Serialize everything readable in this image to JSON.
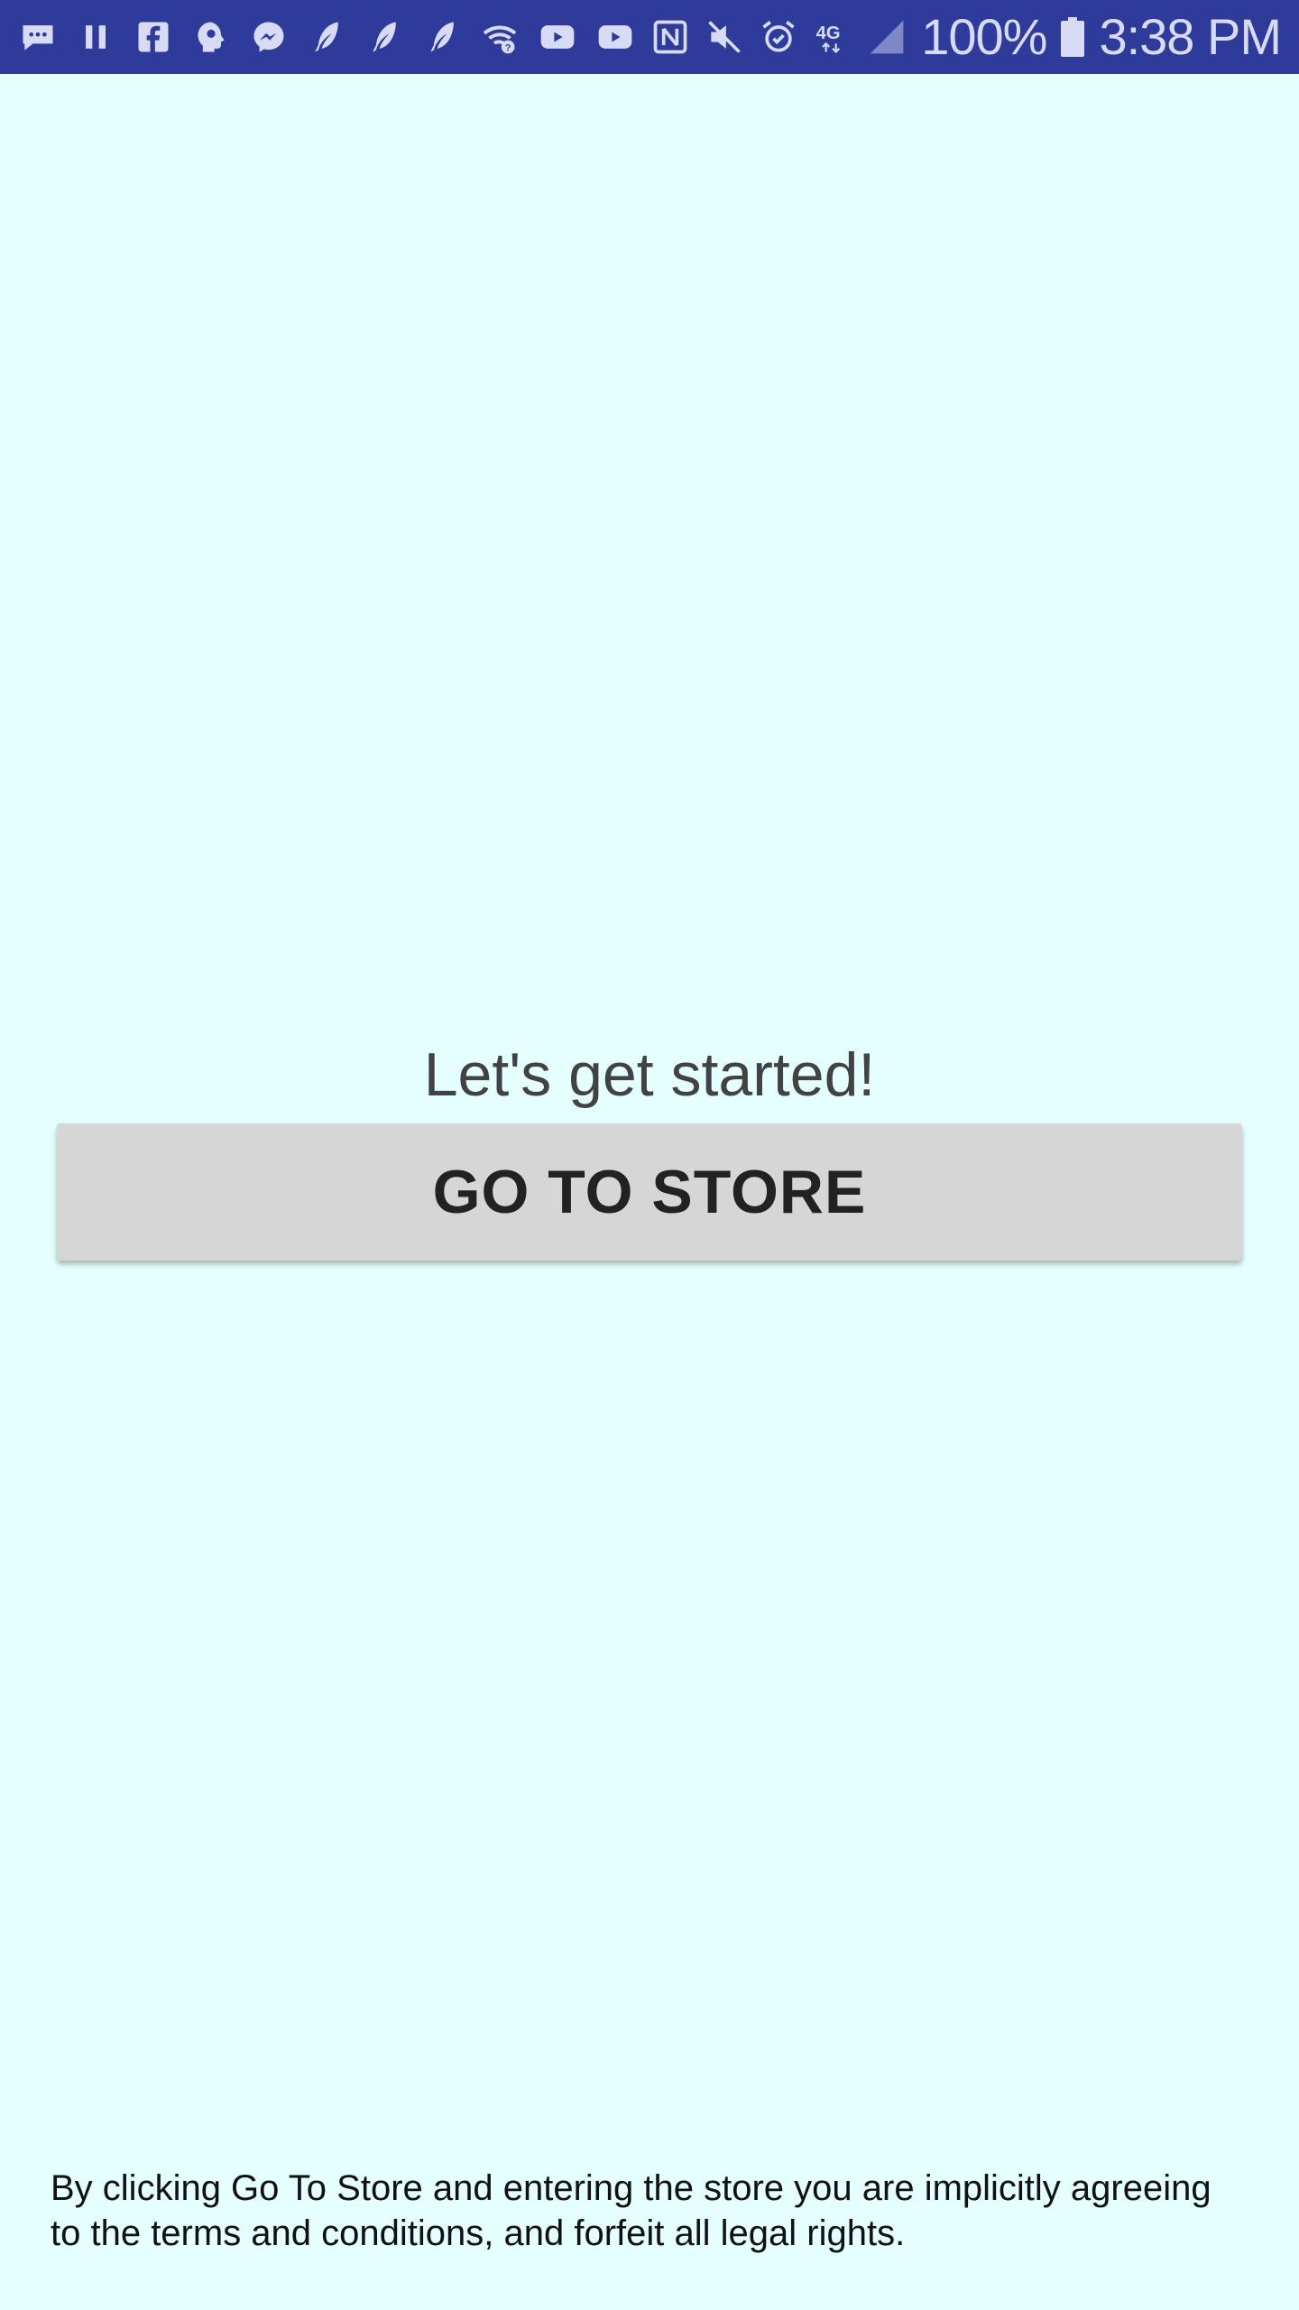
{
  "status_bar": {
    "battery_percent": "100%",
    "time": "3:38 PM",
    "network_label": "4G",
    "background_color": "#2f3b9b",
    "icons_left": [
      "chat-icon",
      "pause-icon",
      "facebook-icon",
      "mind-icon",
      "messenger-icon",
      "feather-icon",
      "feather-icon",
      "feather-icon",
      "wifi-question-icon",
      "youtube-icon",
      "youtube-icon"
    ],
    "icons_right": [
      "nfc-icon",
      "mute-icon",
      "alarm-icon",
      "lte-icon",
      "signal-icon",
      "battery-icon"
    ]
  },
  "main": {
    "title": "Let's get started!",
    "button_label": "GO TO STORE",
    "background_color": "#e4fffd",
    "button_color": "#d6d6d6"
  },
  "footer": {
    "disclaimer": "By clicking Go To Store and entering the store you are implicitly agreeing to the terms and conditions, and forfeit all legal rights."
  }
}
